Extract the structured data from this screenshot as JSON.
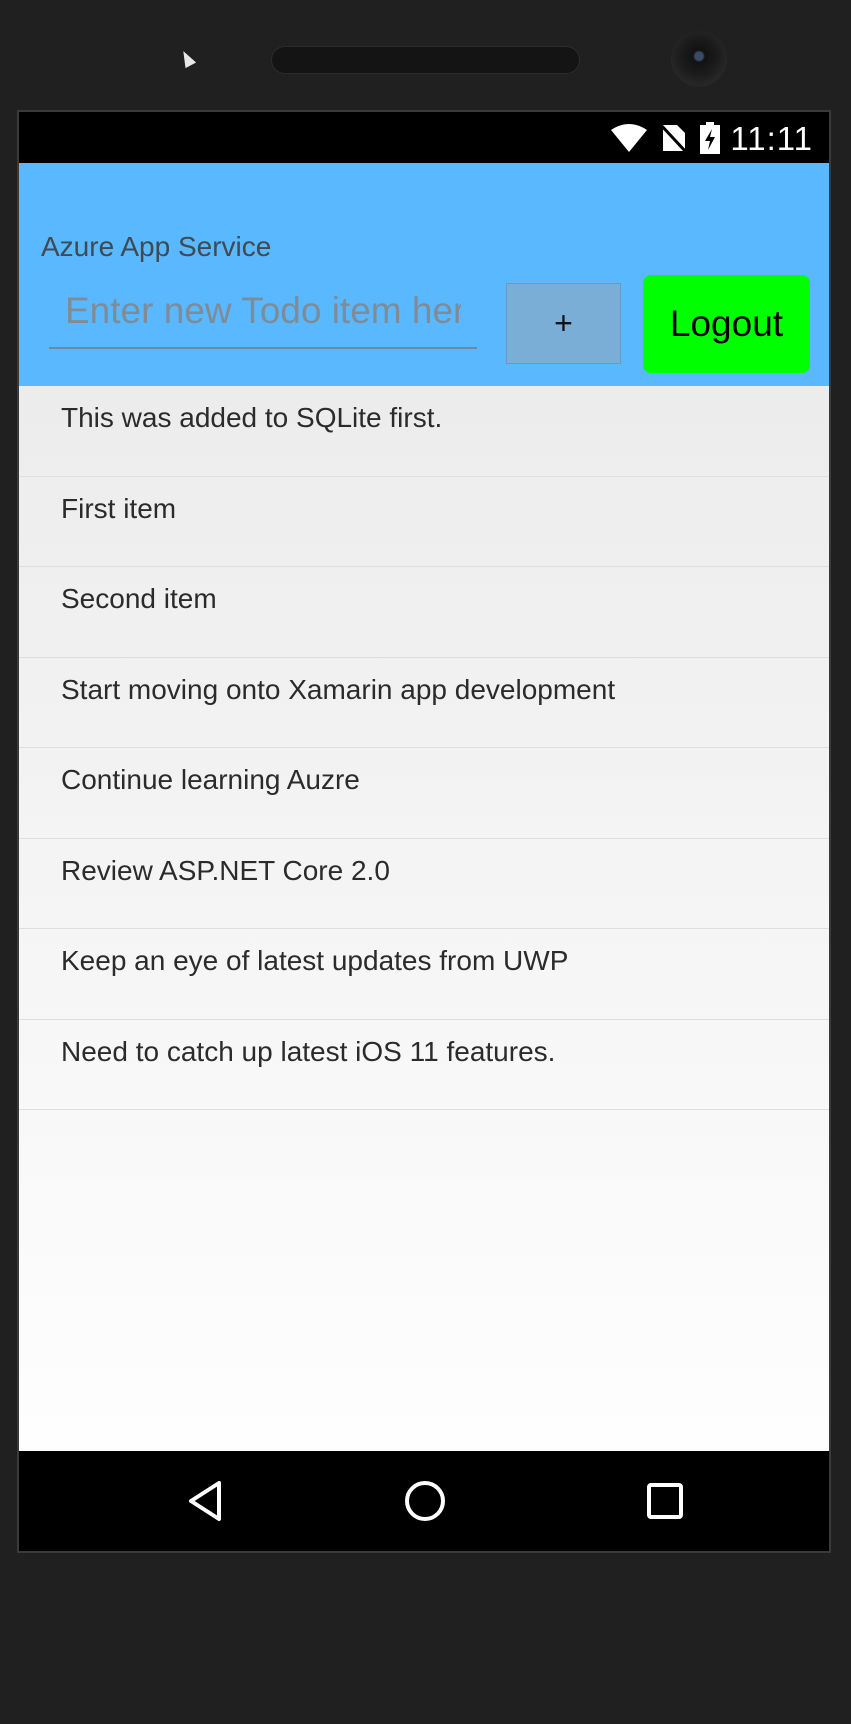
{
  "status_bar": {
    "time": "11:11",
    "icons": [
      "wifi-icon",
      "no-sim-icon",
      "battery-charging-icon"
    ]
  },
  "app": {
    "title": "Azure App Service",
    "input_placeholder": "Enter new Todo item here",
    "add_label": "+",
    "logout_label": "Logout",
    "colors": {
      "header": "#5ab8ff",
      "add_button": "#7aaed6",
      "logout_button": "#00ff00"
    }
  },
  "todo_items": [
    "This was added to SQLite first.",
    "First item",
    "Second item",
    "Start moving onto Xamarin app development",
    "Continue learning Auzre",
    "Review ASP.NET Core 2.0",
    "Keep an eye of latest updates from UWP",
    "Need to catch up latest iOS 11 features."
  ],
  "nav_bar": {
    "buttons": [
      "back-icon",
      "home-icon",
      "recents-icon"
    ]
  }
}
